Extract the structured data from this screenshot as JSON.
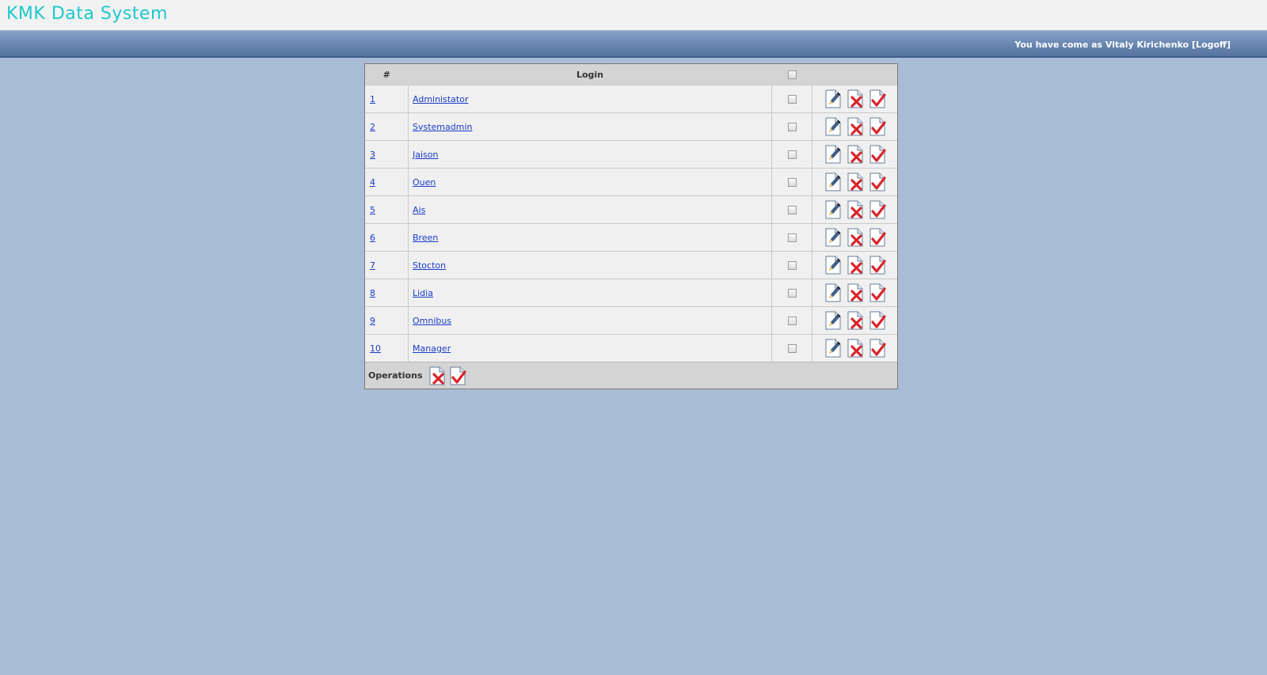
{
  "app": {
    "title": "KMK Data System"
  },
  "user": {
    "text": "You have come as Vitaly Kirichenko",
    "logoff": "[Logoff]"
  },
  "table": {
    "columns": {
      "num": "#",
      "login": "Login"
    },
    "rows": [
      {
        "num": "1",
        "login": "Administator"
      },
      {
        "num": "2",
        "login": "Systemadmin"
      },
      {
        "num": "3",
        "login": "Jaison"
      },
      {
        "num": "4",
        "login": "Ouen"
      },
      {
        "num": "5",
        "login": "Ais"
      },
      {
        "num": "6",
        "login": "Breen"
      },
      {
        "num": "7",
        "login": "Stocton"
      },
      {
        "num": "8",
        "login": "Lidia"
      },
      {
        "num": "9",
        "login": "Omnibus"
      },
      {
        "num": "10",
        "login": "Manager"
      }
    ],
    "row_actions": [
      "edit-icon",
      "delete-icon",
      "approve-icon"
    ],
    "operations_label": "Operations",
    "operations_actions": [
      "delete-icon",
      "approve-icon"
    ]
  },
  "colors": {
    "title": "#1ec8cc",
    "background": "#a9bcd6",
    "link": "#1a3cc8",
    "delete": "#d8262b",
    "approve": "#d8262b"
  }
}
